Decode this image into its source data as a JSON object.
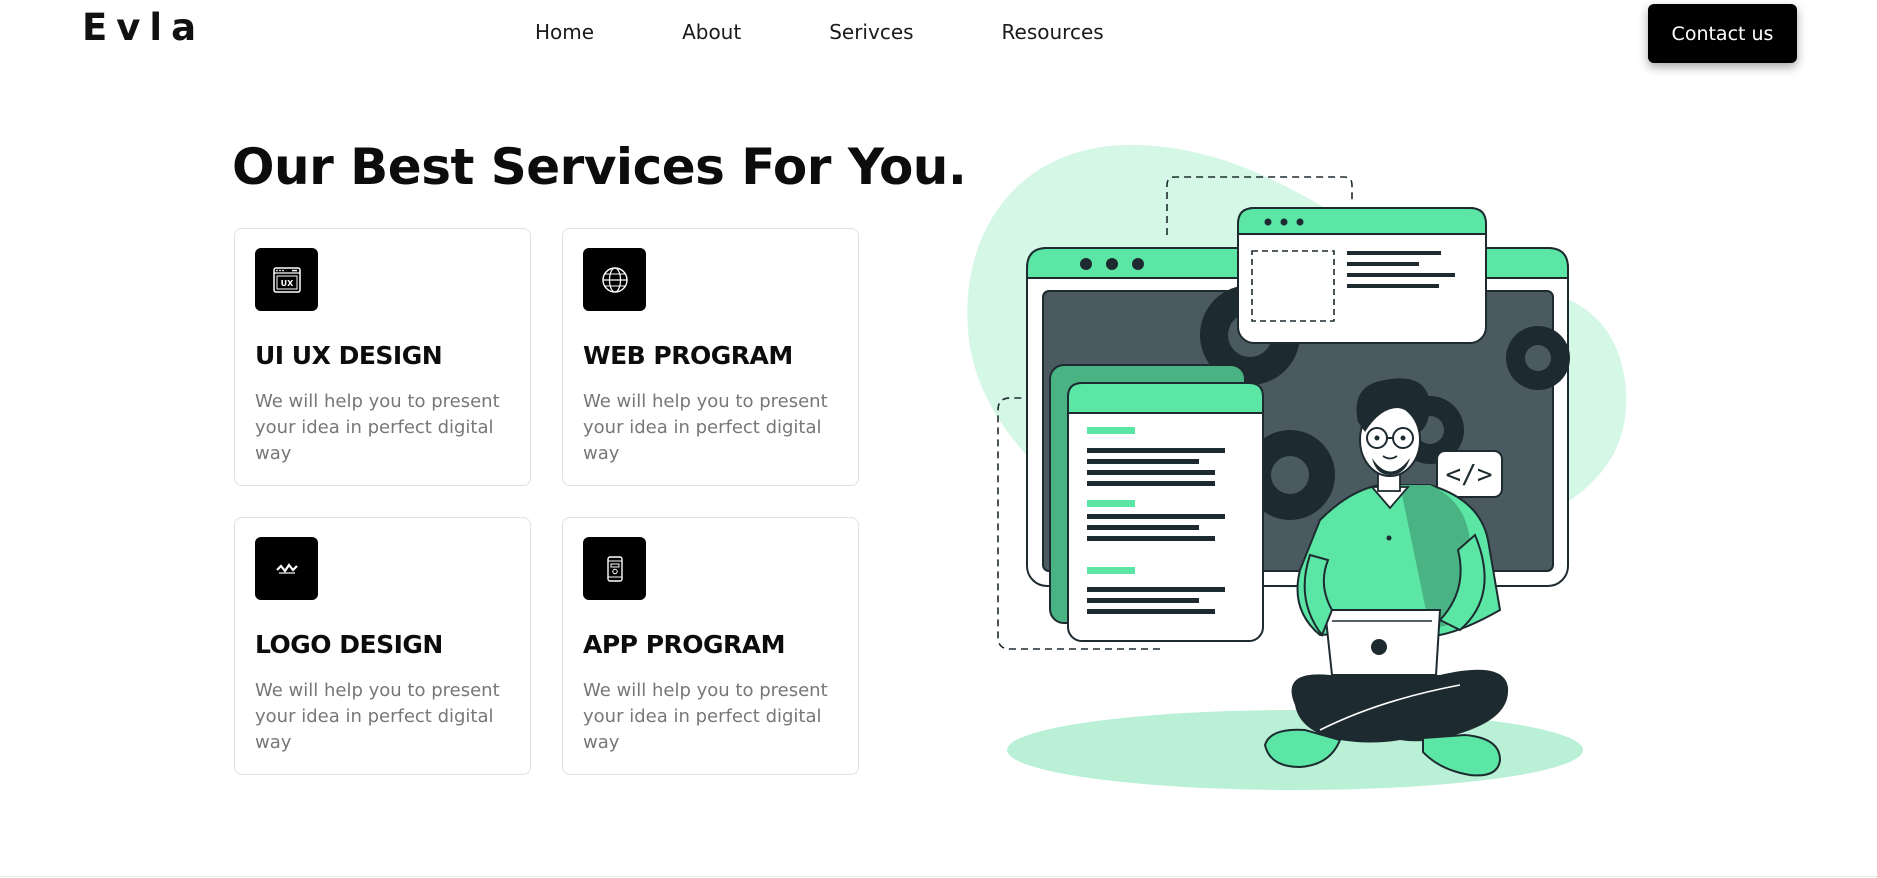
{
  "brand": {
    "logo": "Evla"
  },
  "nav": {
    "links": [
      "Home",
      "About",
      "Serivces",
      "Resources"
    ],
    "contact_label": "Contact us"
  },
  "main": {
    "heading": "Our Best Services For You.",
    "cards": [
      {
        "icon": "ux-window-icon",
        "icon_text": "UX",
        "title": "UI UX DESIGN",
        "desc": "We will help you to present your idea in perfect digital way"
      },
      {
        "icon": "globe-icon",
        "title": "WEB PROGRAM",
        "desc": "We will help you to present your idea in perfect digital way"
      },
      {
        "icon": "logo-mark-icon",
        "title": "LOGO DESIGN",
        "desc": "We will help you to present your idea in perfect digital way"
      },
      {
        "icon": "mobile-app-icon",
        "title": "APP PROGRAM",
        "desc": "We will help you to present your idea in perfect digital way"
      }
    ]
  },
  "illustration": {
    "code_tag": "</>"
  },
  "colors": {
    "accent": "#5ce6a5",
    "accent_light": "#d4f7e6",
    "dark": "#1d2b30",
    "screen": "#4a5a60"
  }
}
